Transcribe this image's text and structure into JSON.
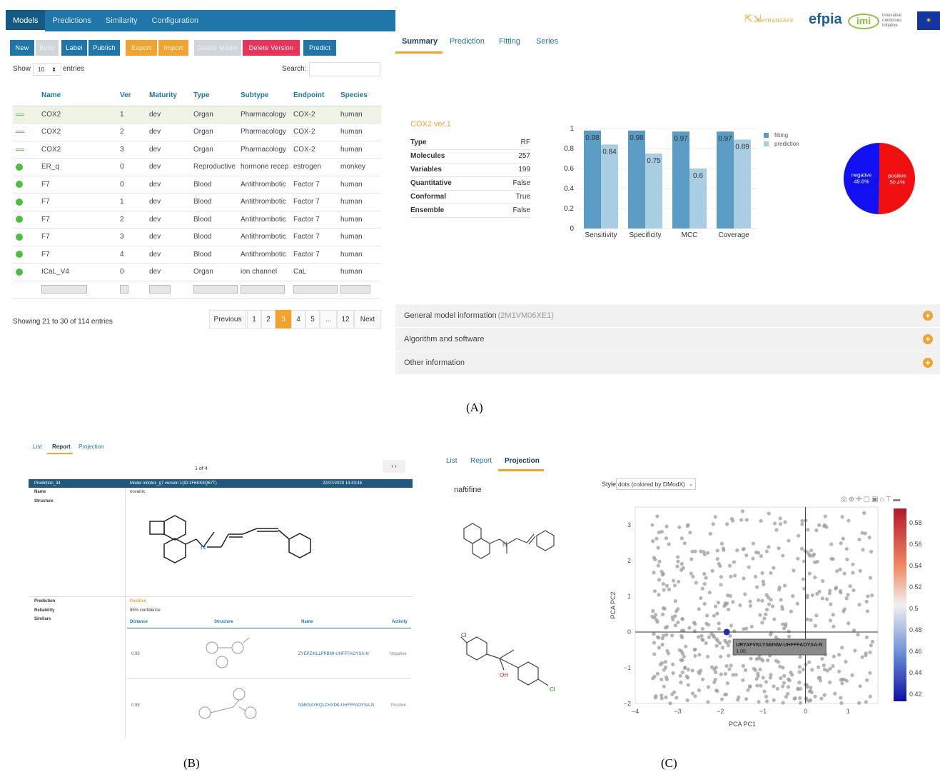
{
  "nav": {
    "tabs": [
      "Models",
      "Predictions",
      "Similarity",
      "Configuration"
    ]
  },
  "toolbar": {
    "new": "New",
    "build": "Build",
    "label": "Label",
    "publish": "Publish",
    "export": "Export",
    "import": "Import",
    "delete_model": "Delete Model",
    "delete_version": "Delete Version",
    "predict": "Predict"
  },
  "table_ctrl": {
    "show": "Show",
    "show_value": "10",
    "entries": "entries",
    "search": "Search:"
  },
  "table": {
    "headers": [
      "Name",
      "Ver",
      "Maturity",
      "Type",
      "Subtype",
      "Endpoint",
      "Species"
    ],
    "rows": [
      [
        "COX2",
        "1",
        "dev",
        "Organ",
        "Pharmacology",
        "COX-2",
        "human"
      ],
      [
        "COX2",
        "2",
        "dev",
        "Organ",
        "Pharmacology",
        "COX-2",
        "human"
      ],
      [
        "COX2",
        "3",
        "dev",
        "Organ",
        "Pharmacology",
        "COX-2",
        "human"
      ],
      [
        "ER_q",
        "0",
        "dev",
        "Reproductive",
        "hormone recep",
        "estrogen",
        "monkey"
      ],
      [
        "F7",
        "0",
        "dev",
        "Blood",
        "Antithrombotic",
        "Factor 7",
        "human"
      ],
      [
        "F7",
        "1",
        "dev",
        "Blood",
        "Antithrombotic",
        "Factor 7",
        "human"
      ],
      [
        "F7",
        "2",
        "dev",
        "Blood",
        "Antithrombotic",
        "Factor 7",
        "human"
      ],
      [
        "F7",
        "3",
        "dev",
        "Blood",
        "Antithrombotic",
        "Factor 7",
        "human"
      ],
      [
        "F7",
        "4",
        "dev",
        "Blood",
        "Antithrombotic",
        "Factor 7",
        "human"
      ],
      [
        "ICaL_V4",
        "0",
        "dev",
        "Organ",
        "ion channel",
        "CaL",
        "human"
      ]
    ]
  },
  "table_info": "Showing 21 to 30 of 114 entries",
  "pagination": [
    "Previous",
    "1",
    "2",
    "3",
    "4",
    "5",
    "...",
    "12",
    "Next"
  ],
  "logos": {
    "etransafe": "eTRANSAFE",
    "efpia": "efpia",
    "imi": "imi",
    "imi_sub": "innovative medicines initiative"
  },
  "right_tabs": [
    "Summary",
    "Prediction",
    "Fitting",
    "Series"
  ],
  "summary": {
    "title": "COX2 ver.1",
    "rows": [
      [
        "Type",
        "RF"
      ],
      [
        "Molecules",
        "257"
      ],
      [
        "Variables",
        "199"
      ],
      [
        "Quantitative",
        "False"
      ],
      [
        "Conformal",
        "True"
      ],
      [
        "Ensemble",
        "False"
      ]
    ]
  },
  "chart_data": [
    {
      "type": "bar",
      "categories": [
        "Sensitivity",
        "Specificity",
        "MCC",
        "Coverage"
      ],
      "series": [
        {
          "name": "fitting",
          "values": [
            0.98,
            0.98,
            0.97,
            0.97
          ]
        },
        {
          "name": "prediction",
          "values": [
            0.84,
            0.75,
            0.6,
            0.89
          ]
        }
      ],
      "ylim": [
        0,
        1
      ],
      "yticks": [
        "0",
        "0.2",
        "0.4",
        "0.6",
        "0.8",
        "1"
      ],
      "legend": "top-right"
    },
    {
      "type": "pie",
      "slices": [
        {
          "label": "negative",
          "value": 49.6,
          "text": "49.6%"
        },
        {
          "label": "positive",
          "value": 50.4,
          "text": "50.4%"
        }
      ],
      "colors": [
        "#1010f0",
        "#f01010"
      ]
    },
    {
      "type": "scatter",
      "xlabel": "PCA PC1",
      "ylabel": "PCA PC2",
      "xticks": [
        "−4",
        "−3",
        "−2",
        "−1",
        "0",
        "1"
      ],
      "yticks": [
        "3",
        "2",
        "1",
        "0",
        "−1",
        "−2"
      ],
      "colorbar": [
        "0.58",
        "0.56",
        "0.54",
        "0.52",
        "0.5",
        "0.48",
        "0.46",
        "0.44",
        "0.42"
      ],
      "highlight": {
        "label": "URYAFVKLYSEINW-UHFFFAOYSA-N",
        "value": "1.00"
      }
    }
  ],
  "accordion": [
    {
      "title": "General model information",
      "sub": "(2M1VM06XE1)"
    },
    {
      "title": "Algorithm and software",
      "sub": ""
    },
    {
      "title": "Other information",
      "sub": ""
    }
  ],
  "captions": {
    "a": "(A)",
    "b": "(B)",
    "c": "(C)"
  },
  "panelB": {
    "tabs": [
      "List",
      "Report",
      "Projection"
    ],
    "pager": "1 of 4",
    "arrows": "‹ ›",
    "header": [
      "Prediction_34",
      "Model mitotox_g7 version 1(ID:1F6KK8Q67T)",
      "22/07/2020 14:43:46"
    ],
    "name_label": "Name",
    "name_value": "novartix",
    "structure_label": "Structure",
    "prediction_label": "Prediction",
    "prediction_value": "Positive",
    "reliability_label": "Reliability",
    "reliability_value": "85% confidence",
    "similars_label": "Similars",
    "sim_headers": [
      "Distance",
      "Structure",
      "Name",
      "Activity"
    ],
    "sims": [
      [
        "0.99",
        "ZYEPZIKLLPPBMI-UHFFFAOYSA-N",
        "Negative"
      ],
      [
        "0.98",
        "NMKSAYKQLCHXDK-UHFFFAOYSA-N",
        "Positive"
      ]
    ]
  },
  "panelC": {
    "tabs": [
      "List",
      "Report",
      "Projection"
    ],
    "compound": "naftifine",
    "style_label": "Style",
    "style_value": "dots (colored by DModX)",
    "atom_cl": "Cl",
    "atom_oh": "OH",
    "atom_n": "N"
  }
}
